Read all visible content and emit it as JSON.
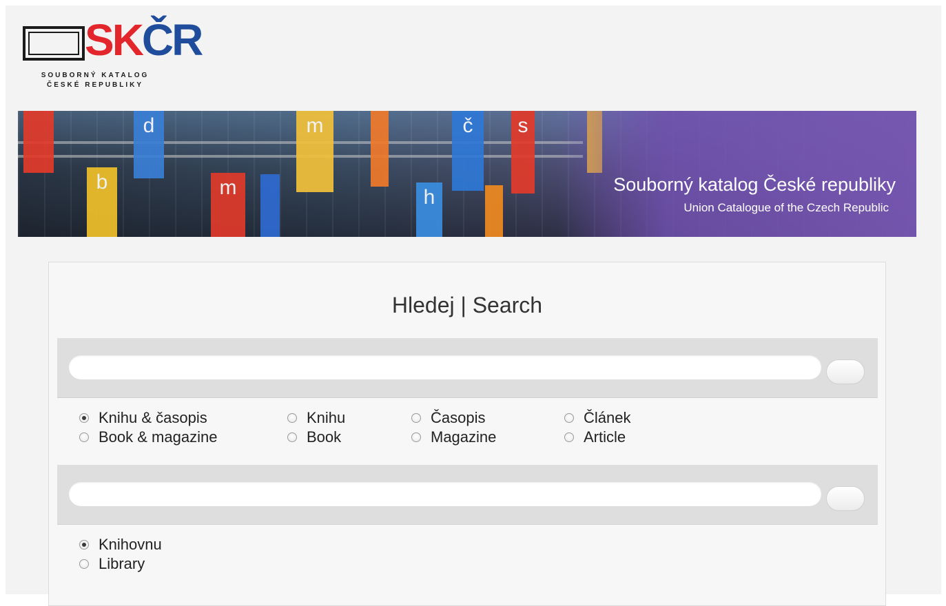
{
  "logo": {
    "mark": "SKČR",
    "mark_part1": "SK",
    "mark_part2": "ČR",
    "subtitle_line1": "SOUBORNÝ KATALOG",
    "subtitle_line2": "ČESKÉ REPUBLIKY",
    "colors": {
      "sk": "#e2262b",
      "cr": "#1f4d9b"
    }
  },
  "banner": {
    "title": "Souborný katalog České republiky",
    "subtitle": "Union Catalogue of the Czech Republic",
    "flags": [
      {
        "letter": "",
        "color": "#e23b2a"
      },
      {
        "letter": "b",
        "color": "#f0c02a"
      },
      {
        "letter": "d",
        "color": "#3a7fd6"
      },
      {
        "letter": "m",
        "color": "#e03a2a"
      },
      {
        "letter": "",
        "color": "#2f6ad1"
      },
      {
        "letter": "m",
        "color": "#f2c13a"
      },
      {
        "letter": "",
        "color": "#f07a2a"
      },
      {
        "letter": "h",
        "color": "#3a8ee0"
      },
      {
        "letter": "č",
        "color": "#2f78d6"
      },
      {
        "letter": "",
        "color": "#f08a20"
      },
      {
        "letter": "s",
        "color": "#e23b2a"
      },
      {
        "letter": "",
        "color": "#f0b43a"
      }
    ]
  },
  "search_panel": {
    "title": "Hledej | Search",
    "catalog_search": {
      "input_value": "",
      "placeholder": "",
      "options": [
        {
          "label": "Knihu & časopis",
          "checked": true
        },
        {
          "label": "Knihu",
          "checked": false
        },
        {
          "label": "Časopis",
          "checked": false
        },
        {
          "label": "Článek",
          "checked": false
        },
        {
          "label": "Book & magazine",
          "checked": false
        },
        {
          "label": "Book",
          "checked": false
        },
        {
          "label": "Magazine",
          "checked": false
        },
        {
          "label": "Article",
          "checked": false
        }
      ]
    },
    "library_search": {
      "input_value": "",
      "placeholder": "",
      "options": [
        {
          "label": "Knihovnu",
          "checked": true
        },
        {
          "label": "Library",
          "checked": false
        }
      ]
    }
  }
}
